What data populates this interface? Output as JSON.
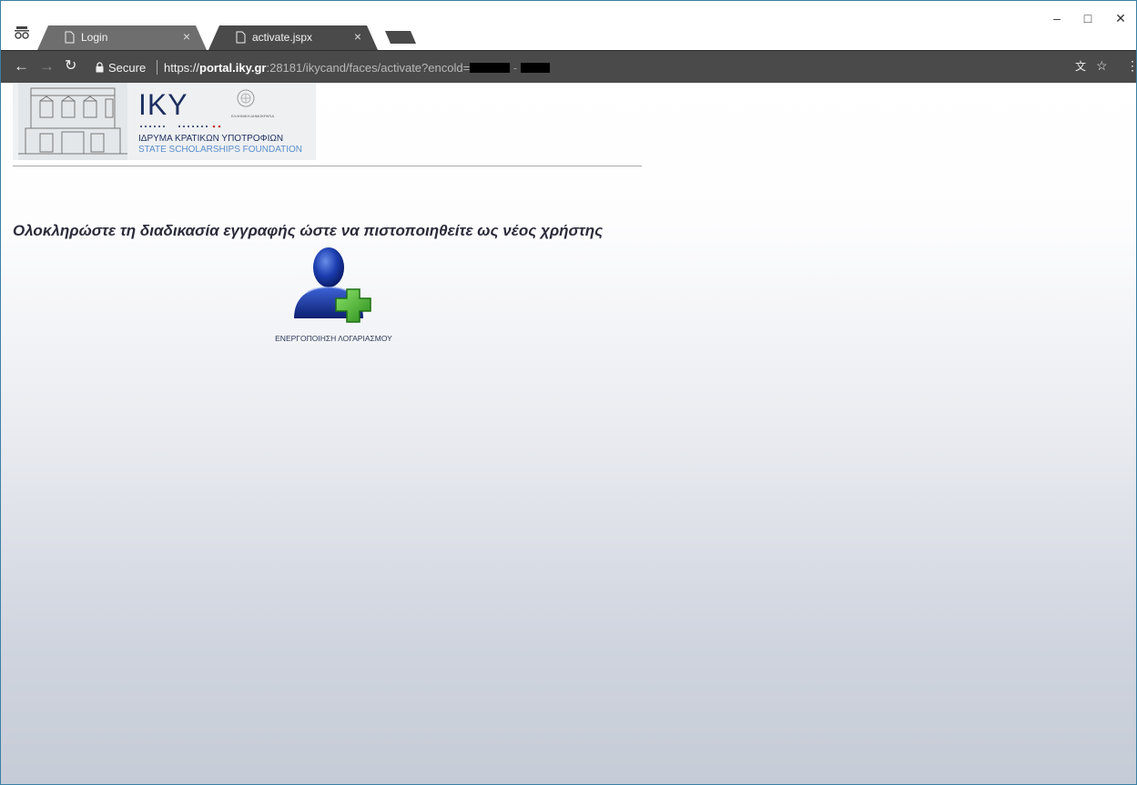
{
  "browser": {
    "tabs": [
      {
        "title": "Login",
        "active": false
      },
      {
        "title": "activate.jspx",
        "active": true
      }
    ],
    "security_label": "Secure",
    "url": {
      "scheme": "https://",
      "host": "portal.iky.gr",
      "rest": ":28181/ikycand/faces/activate?encold="
    }
  },
  "page": {
    "logo": {
      "name": "IKY",
      "line1": "ΙΔΡΥΜΑ ΚΡΑΤΙΚΩΝ ΥΠΟΤΡΟΦΙΩΝ",
      "line2": "STATE SCHOLARSHIPS FOUNDATION",
      "emblem_text": "ΕΛΛΗΝΙΚΗ ΔΗΜΟΚΡΑΤΙΑ"
    },
    "heading": "Ολοκληρώστε τη διαδικασία εγγραφής ώστε να πιστοποιηθείτε ως νέος χρήστης",
    "activate_label": "ΕΝΕΡΓΟΠΟΙΗΣΗ ΛΟΓΑΡΙΑΣΜΟΥ"
  }
}
